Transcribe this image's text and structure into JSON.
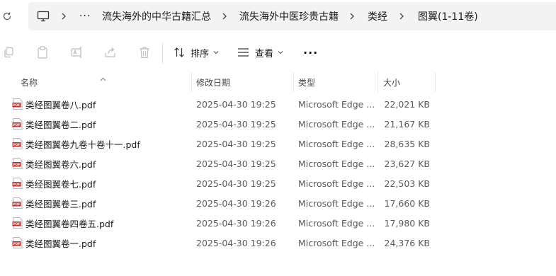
{
  "breadcrumb": {
    "items": [
      "流失海外的中华古籍汇总",
      "流失海外中医珍贵古籍",
      "类经",
      "图翼(1-11卷)"
    ],
    "overflow": "···"
  },
  "icons": {
    "refresh": "refresh-icon",
    "computer": "computer-icon",
    "copy": "copy-icon",
    "paste": "paste-icon",
    "rename": "rename-icon",
    "share": "share-icon",
    "delete": "delete-icon",
    "sort": "sort-icon",
    "view": "view-icon",
    "more": "more-icon",
    "pdf": "pdf-file-icon"
  },
  "toolbar": {
    "sort_label": "排序",
    "view_label": "查看",
    "more_label": "···"
  },
  "columns": {
    "name": "名称",
    "date": "修改日期",
    "type": "类型",
    "size": "大小"
  },
  "files": [
    {
      "name": "类经图翼卷八.pdf",
      "date": "2025-04-30 19:25",
      "type": "Microsoft Edge ...",
      "size": "22,021 KB"
    },
    {
      "name": "类经图翼卷二.pdf",
      "date": "2025-04-30 19:25",
      "type": "Microsoft Edge ...",
      "size": "21,167 KB"
    },
    {
      "name": "类经图翼卷九卷十卷十一.pdf",
      "date": "2025-04-30 19:25",
      "type": "Microsoft Edge ...",
      "size": "28,635 KB"
    },
    {
      "name": "类经图翼卷六.pdf",
      "date": "2025-04-30 19:25",
      "type": "Microsoft Edge ...",
      "size": "23,627 KB"
    },
    {
      "name": "类经图翼卷七.pdf",
      "date": "2025-04-30 19:25",
      "type": "Microsoft Edge ...",
      "size": "22,503 KB"
    },
    {
      "name": "类经图翼卷三.pdf",
      "date": "2025-04-30 19:26",
      "type": "Microsoft Edge ...",
      "size": "17,660 KB"
    },
    {
      "name": "类经图翼卷四卷五.pdf",
      "date": "2025-04-30 19:26",
      "type": "Microsoft Edge ...",
      "size": "17,980 KB"
    },
    {
      "name": "类经图翼卷一.pdf",
      "date": "2025-04-30 19:26",
      "type": "Microsoft Edge ...",
      "size": "24,376 KB"
    }
  ],
  "colors": {
    "pdf_red": "#c62828",
    "address_bg": "#f3f3f3",
    "disabled_icon": "#bdbdbd"
  }
}
